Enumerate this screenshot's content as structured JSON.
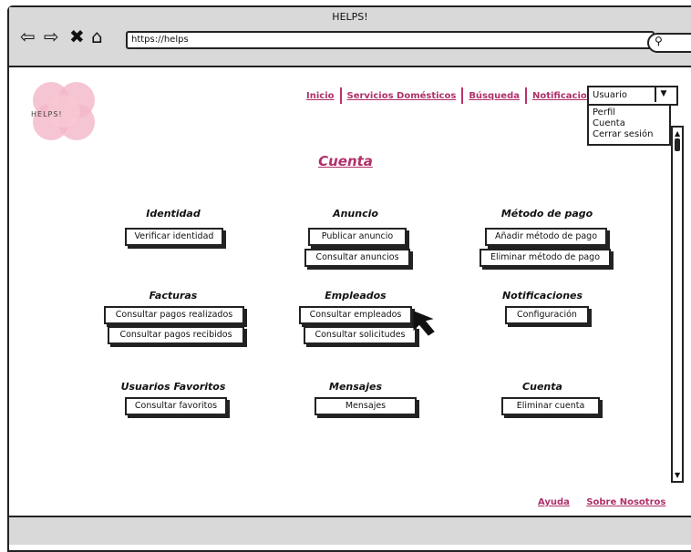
{
  "window": {
    "title": "HELPS!"
  },
  "browser": {
    "url": "https://helps"
  },
  "nav": [
    {
      "label": "Inicio"
    },
    {
      "label": "Servicios Domésticos"
    },
    {
      "label": "Búsqueda"
    },
    {
      "label": "Notificaciones"
    }
  ],
  "user_menu": {
    "selected": "Usuario",
    "options": [
      "Perfil",
      "Cuenta",
      "Cerrar sesión"
    ]
  },
  "logo": {
    "text": "HELPS!"
  },
  "page": {
    "title": "Cuenta"
  },
  "sections": {
    "identidad": {
      "title": "Identidad",
      "buttons": [
        "Verificar identidad"
      ]
    },
    "anuncio": {
      "title": "Anuncio",
      "buttons": [
        "Publicar anuncio",
        "Consultar anuncios"
      ]
    },
    "metodo_pago": {
      "title": "Método de pago",
      "buttons": [
        "Añadir método de pago",
        "Eliminar método de pago"
      ]
    },
    "facturas": {
      "title": "Facturas",
      "buttons": [
        "Consultar pagos realizados",
        "Consultar pagos recibidos"
      ]
    },
    "empleados": {
      "title": "Empleados",
      "buttons": [
        "Consultar empleados",
        "Consultar solicitudes"
      ]
    },
    "notificaciones": {
      "title": "Notificaciones",
      "buttons": [
        "Configuración"
      ]
    },
    "favoritos": {
      "title": "Usuarios Favoritos",
      "buttons": [
        "Consultar favoritos"
      ]
    },
    "mensajes": {
      "title": "Mensajes",
      "buttons": [
        "Mensajes"
      ]
    },
    "cuenta": {
      "title": "Cuenta",
      "buttons": [
        "Eliminar cuenta"
      ]
    }
  },
  "footer": {
    "help": "Ayuda",
    "about": "Sobre Nosotros"
  },
  "colors": {
    "accent": "#b0306a",
    "logo_pink": "#f4b6c8",
    "chrome": "#d9d9d9"
  }
}
